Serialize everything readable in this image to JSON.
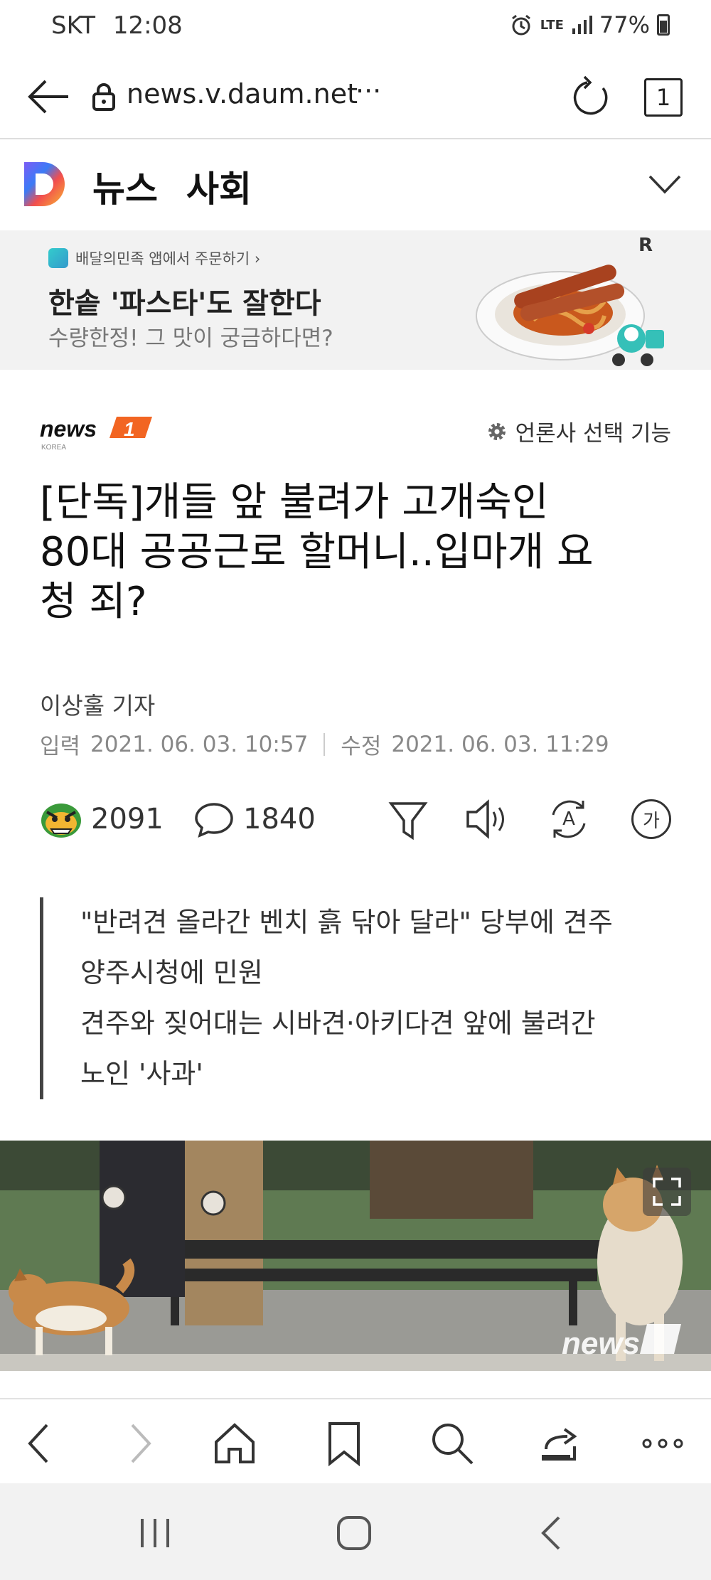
{
  "status_bar": {
    "carrier": "SKT",
    "time": "12:08",
    "network": "LTE",
    "battery": "77%"
  },
  "browser": {
    "url": "news.v.daum.net",
    "url_more": "···",
    "tab_count": "1"
  },
  "header": {
    "service": "뉴스",
    "section": "사회"
  },
  "ad": {
    "source": "배달의민족 앱에서 주문하기 ›",
    "headline": "한솥 '파스타'도 잘한다",
    "sub": "수량한정! 그 맛이 궁금하다면?",
    "close_mark": "R"
  },
  "article": {
    "publisher_select": "언론사 선택 기능",
    "title_lines": [
      "[단독]개들 앞 불려가 고개숙인",
      "80대 공공근로 할머니..입마개 요",
      "청 죄?"
    ],
    "reporter": "이상훌 기자",
    "input_label": "입력",
    "input_date": "2021. 06. 03. 10:57",
    "modified_label": "수정",
    "modified_date": "2021. 06. 03. 11:29",
    "reactions": "2091",
    "comments": "1840",
    "summary": [
      "\"반려견 올라간 벤치 흙 닦아 달라\" 당부에 견주",
      "양주시청에 민원",
      "견주와 짖어대는 시바견·아키다견 앞에 불려간",
      "노인 '사과'"
    ],
    "font_button_label": "가",
    "translate_button_label": "A"
  },
  "colors": {
    "news1_orange": "#f26522",
    "daum_blue": "#3b7bf6"
  }
}
